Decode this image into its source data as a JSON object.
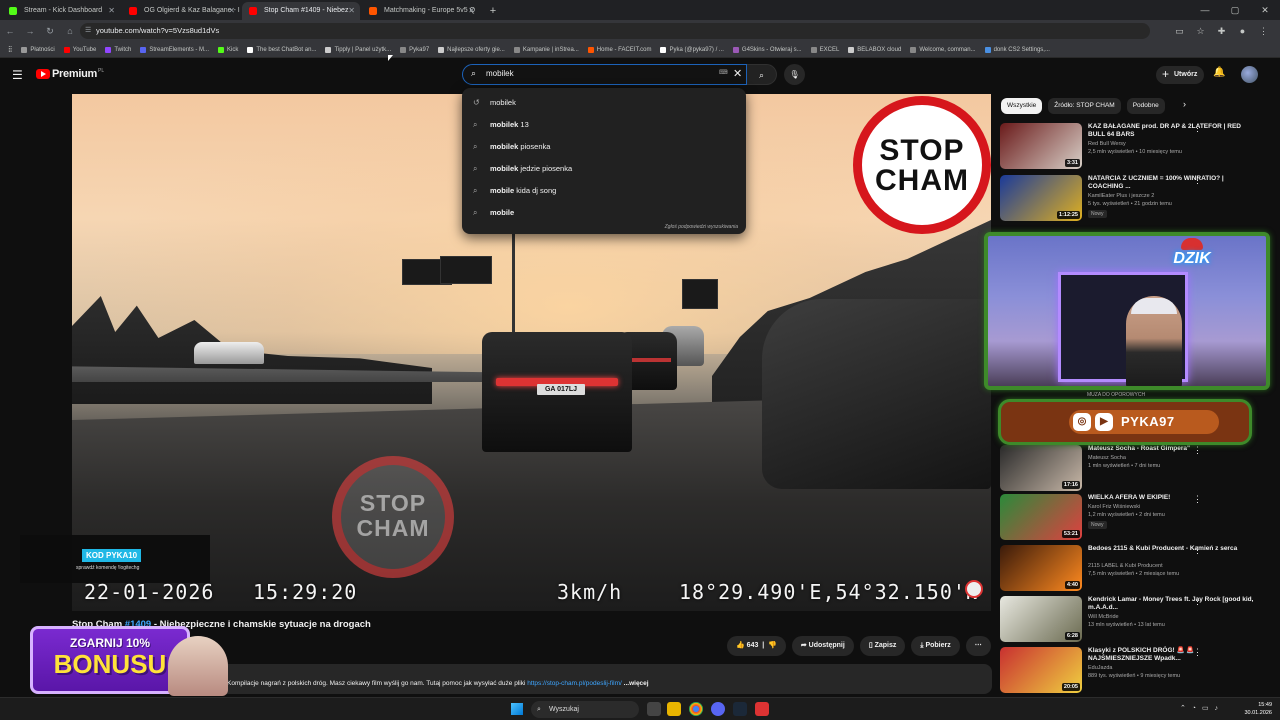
{
  "browser": {
    "tabs": [
      {
        "label": "Stream - Kick Dashboard",
        "color": "#53fc18"
      },
      {
        "label": "OG Olgierd & Kaz Balagane - I",
        "color": "#ff0000"
      },
      {
        "label": "Stop Cham #1409 - Niebez",
        "color": "#ff0000",
        "active": true
      },
      {
        "label": "Matchmaking - Europe 5v5 Q",
        "color": "#ff5500"
      }
    ],
    "new_tab": "+",
    "url": "youtube.com/watch?v=5Vzs8ud1dVs",
    "window_controls": [
      "—",
      "▢",
      "✕"
    ],
    "bookmarks": [
      {
        "label": "Płatności",
        "color": "#999999"
      },
      {
        "label": "YouTube",
        "color": "#ff0000"
      },
      {
        "label": "Twitch",
        "color": "#9146ff"
      },
      {
        "label": "StreamElements - M...",
        "color": "#5865f2"
      },
      {
        "label": "Kick",
        "color": "#53fc18"
      },
      {
        "label": "The best ChatBot an...",
        "color": "#ffffff"
      },
      {
        "label": "Tipply | Panel użytk...",
        "color": "#cccccc"
      },
      {
        "label": "Pyka97",
        "color": "#888888"
      },
      {
        "label": "Najlepsze oferty gie...",
        "color": "#cccccc"
      },
      {
        "label": "Kampanie | inStrea...",
        "color": "#888888"
      },
      {
        "label": "Home - FACEIT.com",
        "color": "#ff5500"
      },
      {
        "label": "Pyka (@pyka97) / ...",
        "color": "#ffffff"
      },
      {
        "label": "G4Skins - Otwieraj s...",
        "color": "#9b59b6"
      },
      {
        "label": "EXCEL",
        "color": "#888888"
      },
      {
        "label": "BELABOX cloud",
        "color": "#cccccc"
      },
      {
        "label": "Welcome, comman...",
        "color": "#888888"
      },
      {
        "label": "donk CS2 Settings,...",
        "color": "#4a90e2"
      }
    ]
  },
  "youtube": {
    "logo": "Premium",
    "logo_suffix": "PL",
    "search_query": "mobilek",
    "create_label": "Utwórz",
    "suggestions": [
      {
        "bold": "",
        "rest": "mobilek",
        "icon": "↺"
      },
      {
        "bold": "mobilek",
        "rest": " 13",
        "icon": "⌕"
      },
      {
        "bold": "mobilek",
        "rest": " piosenka",
        "icon": "⌕"
      },
      {
        "bold": "mobilek",
        "rest": " jedzie piosenka",
        "icon": "⌕"
      },
      {
        "bold": "mobile",
        "rest": " kida dj song",
        "icon": "⌕"
      },
      {
        "bold": "mobile",
        "rest": "",
        "icon": "⌕"
      }
    ],
    "suggestions_footer": "Zgłoś podpowiedzi wyszukiwania"
  },
  "video": {
    "stamp": [
      "STOP",
      "CHAM"
    ],
    "plate": "GA 017LJ",
    "date": "22-01-2026",
    "time": "15:29:20",
    "speed": "3km/h",
    "coords": "18°29.490'E,54°32.150'N",
    "title_prefix": "Stop Cham ",
    "title_hash": "#1409",
    "title_rest": " - Niebezpieczne i chamskie sytuacje na drogach",
    "likes": "643",
    "share": "Udostępnij",
    "save": "Zapisz",
    "download": "Pobierz",
    "desc_text": "Kompilacje nagrań z polskich dróg. Masz ciekawy film wyślij go nam. Tutaj pomoc jak wysyłać duże pliki ",
    "desc_link": "https://stop-cham.pl/podeslij-film/",
    "desc_more": " ...więcej"
  },
  "overlays": {
    "kod_tag": "KOD PYKA10",
    "kod_sub": "sprawdź komendę !logitechg",
    "bonus_l1": "ZGARNIJ 10%",
    "bonus_l2": "BONUSU",
    "dzik": "DZIK",
    "ig_name": "PYKA97",
    "ig_under": "MUZA DO OPOROWYCH"
  },
  "sidebar": {
    "chips": [
      "Wszystkie",
      "Źródło: STOP CHAM",
      "Podobne"
    ],
    "recs": [
      {
        "title": "KAZ BAŁAGANE prod. DR AP & 2LATEFOR | RED BULL 64 BARS",
        "channel": "Red Bull Wersy",
        "meta": "2,5 mln wyświetleń • 10 miesięcy temu",
        "duration": "3:31",
        "badge": "",
        "thumb": [
          "#6a1a1a",
          "#d8d0c8"
        ]
      },
      {
        "title": "NATARCIA Z UCZNIEM = 100% WINRATIO? | COACHING ...",
        "channel": "KamilEater Plus i jeszcze 2",
        "meta": "5 tys. wyświetleń • 21 godzin temu",
        "duration": "1:12:25",
        "badge": "Nowy",
        "thumb": [
          "#1a3a9a",
          "#e0b020"
        ]
      },
      {
        "title": "Mateusz Socha - Roast Gimpera\"",
        "channel": "Mateusz Socha",
        "meta": "1 mln wyświetleń • 7 dni temu",
        "duration": "17:16",
        "badge": "",
        "thumb": [
          "#2a2a2a",
          "#c8b8a8"
        ]
      },
      {
        "title": "WIELKA AFERA W EKIPIE!",
        "channel": "Karol Friz Wiśniewski",
        "meta": "1,2 mln wyświetleń • 2 dni temu",
        "duration": "53:21",
        "badge": "Nowy",
        "thumb": [
          "#2a8a3a",
          "#e04040"
        ]
      },
      {
        "title": "Bedoes 2115 & Kubi Producent - Kamień z serca",
        "channel": "2115 LABEL & Kubi Producent",
        "meta": "7,5 mln wyświetleń • 2 miesiące temu",
        "duration": "4:40",
        "badge": "",
        "thumb": [
          "#3a1a0a",
          "#ff8a20"
        ]
      },
      {
        "title": "Kendrick Lamar - Money Trees ft. Jay Rock [good kid, m.A.A.d...",
        "channel": "Will McBride",
        "meta": "13 mln wyświetleń • 13 lat temu",
        "duration": "6:28",
        "badge": "",
        "thumb": [
          "#e8e8e0",
          "#6a6a50"
        ]
      },
      {
        "title": "Klasyki z POLSKICH DRÓG! 🚨 🚨 NAJŚMIESZNIEJSZE Wpadk...",
        "channel": "EduJazda",
        "meta": "889 tys. wyświetleń • 9 miesięcy temu",
        "duration": "20:05",
        "badge": "",
        "thumb": [
          "#c83030",
          "#f0d040"
        ]
      }
    ]
  },
  "taskbar": {
    "search": "Wyszukaj",
    "time": "15:49",
    "date": "30.01.2026",
    "tray": "⌃ ◔ ▭ ♪"
  }
}
